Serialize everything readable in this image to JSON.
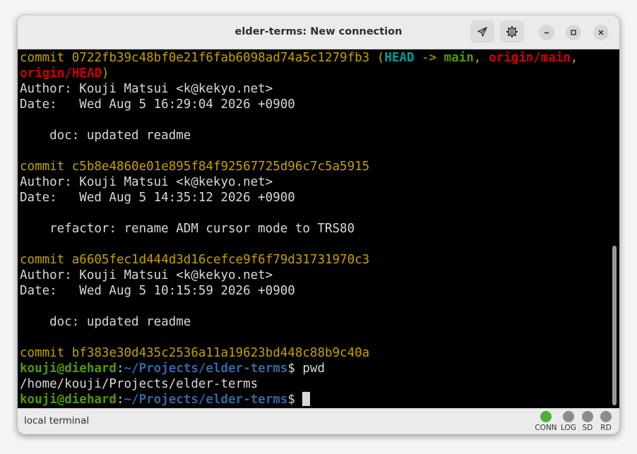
{
  "window": {
    "title": "elder-terms: New connection"
  },
  "toolbar": {
    "send_icon": "send-icon",
    "settings_icon": "gear-icon",
    "minimize_icon": "minimize-icon",
    "maximize_icon": "maximize-icon",
    "close_icon": "close-icon"
  },
  "terminal": {
    "commits": [
      {
        "label": "commit",
        "hash": "0722fb39c48bf0e21f6fab6098ad74a5c1279fb3",
        "refs": {
          "open": "(",
          "head": "HEAD",
          "arrow": "->",
          "branch": "main",
          "sep1": ",",
          "origin_main": "origin/main",
          "sep2": ",",
          "origin_head": "origin/HEAD",
          "close": ")"
        },
        "author": "Author: Kouji Matsui <k@kekyo.net>",
        "date": "Date:   Wed Aug 5 16:29:04 2026 +0900",
        "message": "    doc: updated readme"
      },
      {
        "label": "commit",
        "hash": "c5b8e4860e01e895f84f92567725d96c7c5a5915",
        "author": "Author: Kouji Matsui <k@kekyo.net>",
        "date": "Date:   Wed Aug 5 14:35:12 2026 +0900",
        "message": "    refactor: rename ADM cursor mode to TRS80"
      },
      {
        "label": "commit",
        "hash": "a6605fec1d444d3d16cefce9f6f79d31731970c3",
        "author": "Author: Kouji Matsui <k@kekyo.net>",
        "date": "Date:   Wed Aug 5 10:15:59 2026 +0900",
        "message": "    doc: updated readme"
      },
      {
        "label": "commit",
        "hash": "bf383e30d435c2536a11a19623bd448c88b9c40a"
      }
    ],
    "prompt": {
      "user_host": "kouji@diehard",
      "colon": ":",
      "path": "~/Projects/elder-terms",
      "symbol": "$"
    },
    "command": " pwd",
    "output": "/home/kouji/Projects/elder-terms"
  },
  "status": {
    "text": "local terminal",
    "indicators": [
      {
        "label": "CONN",
        "color": "#4caf3a",
        "active": true
      },
      {
        "label": "LOG",
        "color": "#8c8c8c",
        "active": false
      },
      {
        "label": "SD",
        "color": "#8c8c8c",
        "active": false
      },
      {
        "label": "RD",
        "color": "#8c8c8c",
        "active": false
      }
    ]
  },
  "colors": {
    "commit_yellow": "#c4a000",
    "head_cyan": "#06989a",
    "branch_green": "#4e9a06",
    "origin_red": "#cc0000",
    "path_blue": "#3465a4"
  }
}
